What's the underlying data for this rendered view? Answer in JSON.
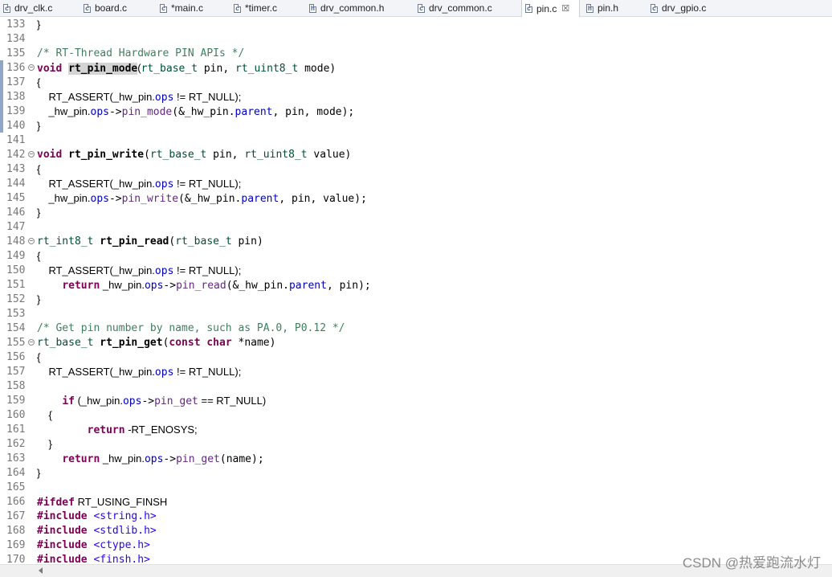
{
  "tabs": [
    {
      "label": "drv_clk.c",
      "type": "c",
      "active": false
    },
    {
      "label": "board.c",
      "type": "c",
      "active": false
    },
    {
      "label": "*main.c",
      "type": "c",
      "active": false
    },
    {
      "label": "*timer.c",
      "type": "c",
      "active": false
    },
    {
      "label": "drv_common.h",
      "type": "h",
      "active": false
    },
    {
      "label": "drv_common.c",
      "type": "c",
      "active": false
    },
    {
      "label": "pin.c",
      "type": "c",
      "active": true
    },
    {
      "label": "pin.h",
      "type": "h",
      "active": false
    },
    {
      "label": "drv_gpio.c",
      "type": "c",
      "active": false
    }
  ],
  "tab_close_glyph": "☒",
  "lines": [
    {
      "n": "133",
      "fold": false,
      "tokens": [
        [
          "pl",
          "}"
        ]
      ]
    },
    {
      "n": "134",
      "fold": false,
      "tokens": []
    },
    {
      "n": "135",
      "fold": false,
      "tokens": [
        [
          "cm",
          "/* RT-Thread Hardware PIN APIs */"
        ]
      ]
    },
    {
      "n": "136",
      "fold": true,
      "tokens": [
        [
          "kw",
          "void"
        ],
        [
          "",
          " "
        ],
        [
          "fnhl",
          "rt_pin_mode"
        ],
        [
          "pl",
          "("
        ],
        [
          "ty",
          "rt_base_t"
        ],
        [
          "",
          " pin, "
        ],
        [
          "ty",
          "rt_uint8_t"
        ],
        [
          "",
          " mode)"
        ]
      ]
    },
    {
      "n": "137",
      "fold": false,
      "tokens": [
        [
          "pl",
          "{"
        ]
      ]
    },
    {
      "n": "138",
      "fold": false,
      "tokens": [
        [
          "pl",
          "    RT_ASSERT(_hw_pin."
        ],
        [
          "mem",
          "ops"
        ],
        [
          "pl",
          " != RT_NULL);"
        ]
      ]
    },
    {
      "n": "139",
      "fold": false,
      "tokens": [
        [
          "pl",
          "    _hw_pin."
        ],
        [
          "mem",
          "ops"
        ],
        [
          "",
          "->"
        ],
        [
          "call",
          "pin_mode"
        ],
        [
          "",
          "(&_hw_pin."
        ],
        [
          "mem",
          "parent"
        ],
        [
          "",
          ", pin, mode);"
        ]
      ]
    },
    {
      "n": "140",
      "fold": false,
      "tokens": [
        [
          "pl",
          "}"
        ]
      ]
    },
    {
      "n": "141",
      "fold": false,
      "tokens": []
    },
    {
      "n": "142",
      "fold": true,
      "tokens": [
        [
          "kw",
          "void"
        ],
        [
          "",
          " "
        ],
        [
          "fn",
          "rt_pin_write"
        ],
        [
          "",
          "("
        ],
        [
          "ty",
          "rt_base_t"
        ],
        [
          "",
          " pin, "
        ],
        [
          "ty",
          "rt_uint8_t"
        ],
        [
          "",
          " value)"
        ]
      ]
    },
    {
      "n": "143",
      "fold": false,
      "tokens": [
        [
          "pl",
          "{"
        ]
      ]
    },
    {
      "n": "144",
      "fold": false,
      "tokens": [
        [
          "pl",
          "    RT_ASSERT(_hw_pin."
        ],
        [
          "mem",
          "ops"
        ],
        [
          "pl",
          " != RT_NULL);"
        ]
      ]
    },
    {
      "n": "145",
      "fold": false,
      "tokens": [
        [
          "pl",
          "    _hw_pin."
        ],
        [
          "mem",
          "ops"
        ],
        [
          "",
          "->"
        ],
        [
          "call",
          "pin_write"
        ],
        [
          "",
          "(&_hw_pin."
        ],
        [
          "mem",
          "parent"
        ],
        [
          "",
          ", pin, value);"
        ]
      ]
    },
    {
      "n": "146",
      "fold": false,
      "tokens": [
        [
          "pl",
          "}"
        ]
      ]
    },
    {
      "n": "147",
      "fold": false,
      "tokens": []
    },
    {
      "n": "148",
      "fold": true,
      "tokens": [
        [
          "ty",
          "rt_int8_t"
        ],
        [
          "",
          " "
        ],
        [
          "fn",
          "rt_pin_read"
        ],
        [
          "",
          "("
        ],
        [
          "ty",
          "rt_base_t"
        ],
        [
          "",
          " pin)"
        ]
      ]
    },
    {
      "n": "149",
      "fold": false,
      "tokens": [
        [
          "pl",
          "{"
        ]
      ]
    },
    {
      "n": "150",
      "fold": false,
      "tokens": [
        [
          "pl",
          "    RT_ASSERT(_hw_pin."
        ],
        [
          "mem",
          "ops"
        ],
        [
          "pl",
          " != RT_NULL);"
        ]
      ]
    },
    {
      "n": "151",
      "fold": false,
      "tokens": [
        [
          "",
          "    "
        ],
        [
          "kw",
          "return"
        ],
        [
          "pl",
          " _hw_pin."
        ],
        [
          "mem",
          "ops"
        ],
        [
          "",
          "->"
        ],
        [
          "call",
          "pin_read"
        ],
        [
          "",
          "(&_hw_pin."
        ],
        [
          "mem",
          "parent"
        ],
        [
          "",
          ", pin);"
        ]
      ]
    },
    {
      "n": "152",
      "fold": false,
      "tokens": [
        [
          "pl",
          "}"
        ]
      ]
    },
    {
      "n": "153",
      "fold": false,
      "tokens": []
    },
    {
      "n": "154",
      "fold": false,
      "tokens": [
        [
          "cm",
          "/* Get pin number by name, such as PA.0, P0.12 */"
        ]
      ]
    },
    {
      "n": "155",
      "fold": true,
      "tokens": [
        [
          "ty",
          "rt_base_t"
        ],
        [
          "",
          " "
        ],
        [
          "fn",
          "rt_pin_get"
        ],
        [
          "",
          "("
        ],
        [
          "kw",
          "const"
        ],
        [
          "",
          " "
        ],
        [
          "kw",
          "char"
        ],
        [
          "",
          " *name)"
        ]
      ]
    },
    {
      "n": "156",
      "fold": false,
      "tokens": [
        [
          "pl",
          "{"
        ]
      ]
    },
    {
      "n": "157",
      "fold": false,
      "tokens": [
        [
          "pl",
          "    RT_ASSERT(_hw_pin."
        ],
        [
          "mem",
          "ops"
        ],
        [
          "pl",
          " != RT_NULL);"
        ]
      ]
    },
    {
      "n": "158",
      "fold": false,
      "tokens": []
    },
    {
      "n": "159",
      "fold": false,
      "tokens": [
        [
          "",
          "    "
        ],
        [
          "kw",
          "if"
        ],
        [
          "pl",
          " (_hw_pin."
        ],
        [
          "mem",
          "ops"
        ],
        [
          "",
          "->"
        ],
        [
          "call",
          "pin_get"
        ],
        [
          "pl",
          " == RT_NULL)"
        ]
      ]
    },
    {
      "n": "160",
      "fold": false,
      "tokens": [
        [
          "pl",
          "    {"
        ]
      ]
    },
    {
      "n": "161",
      "fold": false,
      "tokens": [
        [
          "",
          "        "
        ],
        [
          "kw",
          "return"
        ],
        [
          "pl",
          " -RT_ENOSYS;"
        ]
      ]
    },
    {
      "n": "162",
      "fold": false,
      "tokens": [
        [
          "pl",
          "    }"
        ]
      ]
    },
    {
      "n": "163",
      "fold": false,
      "tokens": [
        [
          "",
          "    "
        ],
        [
          "kw",
          "return"
        ],
        [
          "pl",
          " _hw_pin."
        ],
        [
          "mem",
          "ops"
        ],
        [
          "",
          "->"
        ],
        [
          "call",
          "pin_get"
        ],
        [
          "",
          "(name);"
        ]
      ]
    },
    {
      "n": "164",
      "fold": false,
      "tokens": [
        [
          "pl",
          "}"
        ]
      ]
    },
    {
      "n": "165",
      "fold": false,
      "tokens": []
    },
    {
      "n": "166",
      "fold": false,
      "tokens": [
        [
          "kw",
          "#ifdef"
        ],
        [
          "pl",
          " RT_USING_FINSH"
        ]
      ]
    },
    {
      "n": "167",
      "fold": false,
      "tokens": [
        [
          "kw",
          "#include"
        ],
        [
          "",
          " "
        ],
        [
          "str",
          "<string.h>"
        ]
      ]
    },
    {
      "n": "168",
      "fold": false,
      "tokens": [
        [
          "kw",
          "#include"
        ],
        [
          "",
          " "
        ],
        [
          "str",
          "<stdlib.h>"
        ]
      ]
    },
    {
      "n": "169",
      "fold": false,
      "tokens": [
        [
          "kw",
          "#include"
        ],
        [
          "",
          " "
        ],
        [
          "str",
          "<ctype.h>"
        ]
      ]
    },
    {
      "n": "170",
      "fold": false,
      "tokens": [
        [
          "kw",
          "#include"
        ],
        [
          "",
          " "
        ],
        [
          "str",
          "<finsh.h>"
        ]
      ]
    }
  ],
  "watermark": "CSDN @热爱跑流水灯"
}
